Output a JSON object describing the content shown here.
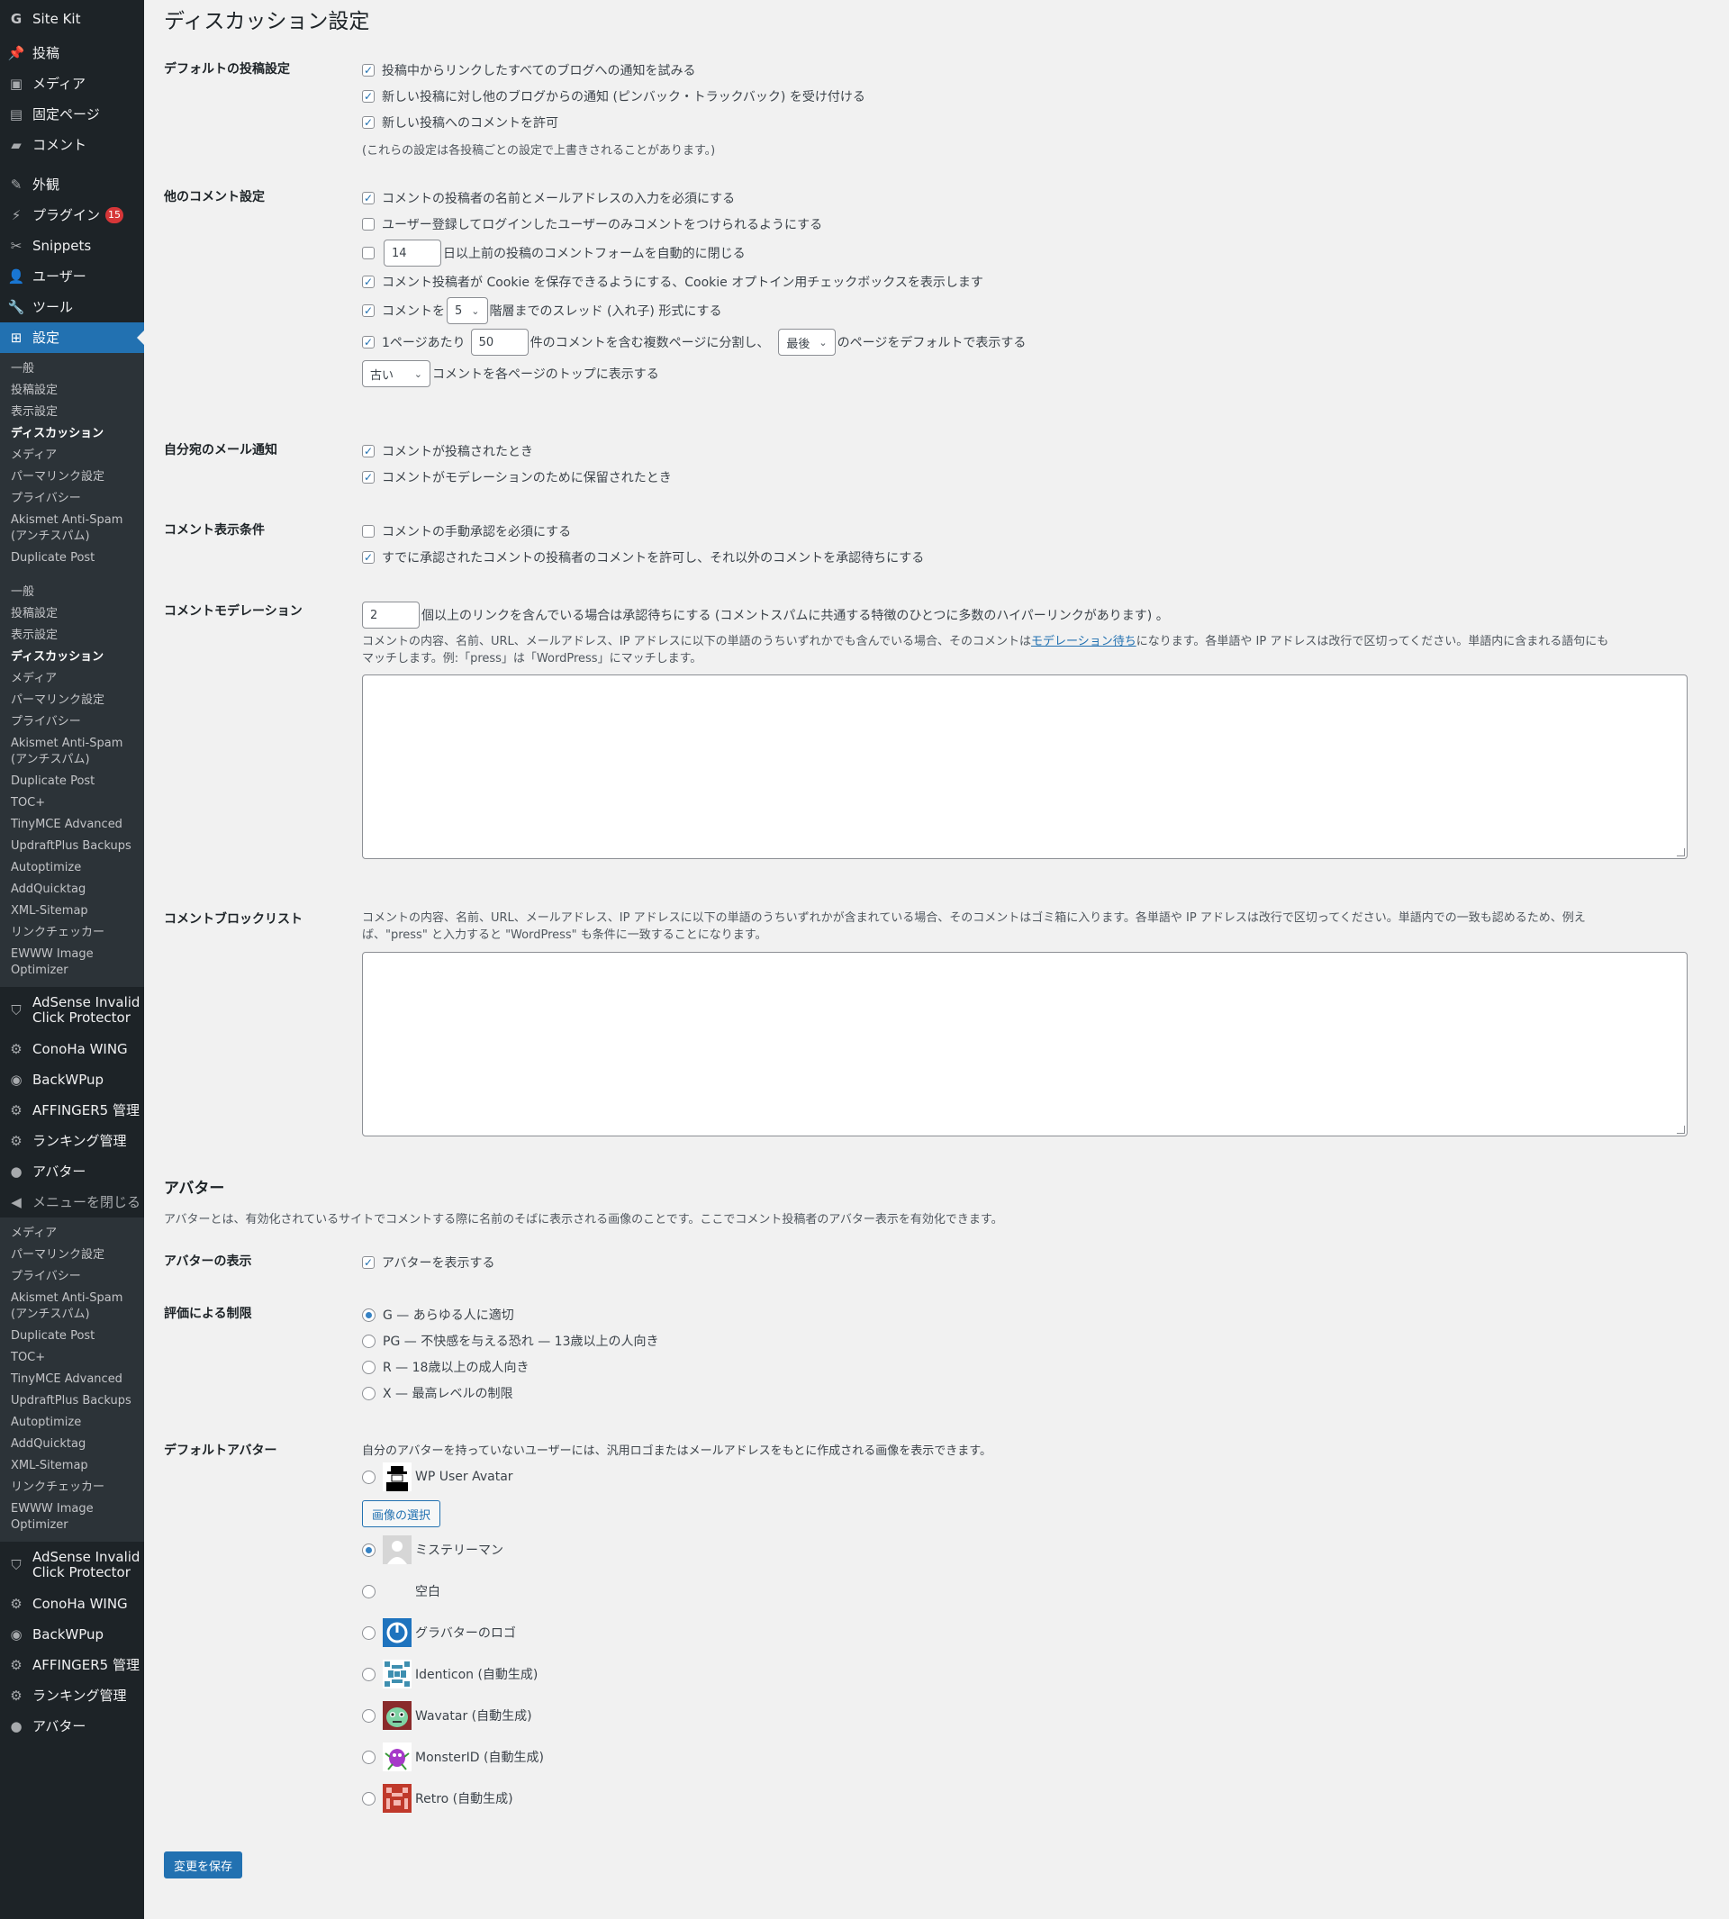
{
  "sidebar": {
    "top_items": [
      {
        "label": "Site Kit",
        "icon": "site-kit-icon"
      },
      {
        "label": "投稿",
        "icon": "pin-icon"
      },
      {
        "label": "メディア",
        "icon": "media-icon"
      },
      {
        "label": "固定ページ",
        "icon": "page-icon"
      },
      {
        "label": "コメント",
        "icon": "comment-icon"
      },
      {
        "label": "外観",
        "icon": "brush-icon"
      },
      {
        "label": "プラグイン",
        "icon": "plugin-icon",
        "badge": "15"
      },
      {
        "label": "Snippets",
        "icon": "snippets-icon"
      },
      {
        "label": "ユーザー",
        "icon": "user-icon"
      },
      {
        "label": "ツール",
        "icon": "wrench-icon"
      },
      {
        "label": "設定",
        "icon": "settings-icon"
      }
    ],
    "submenu_a": [
      "一般",
      "投稿設定",
      "表示設定",
      "ディスカッション",
      "メディア",
      "パーマリンク設定",
      "プライバシー",
      "Akismet Anti-Spam (アンチスパム)",
      "Duplicate Post"
    ],
    "submenu_b": [
      "一般",
      "投稿設定",
      "表示設定",
      "ディスカッション",
      "メディア",
      "パーマリンク設定",
      "プライバシー",
      "Akismet Anti-Spam (アンチスパム)",
      "Duplicate Post",
      "TOC+",
      "TinyMCE Advanced",
      "UpdraftPlus Backups",
      "Autoptimize",
      "AddQuicktag",
      "XML-Sitemap",
      "リンクチェッカー",
      "EWWW Image Optimizer"
    ],
    "plugin_items_a": [
      {
        "label": "AdSense Invalid Click Protector",
        "icon": "shield-icon"
      },
      {
        "label": "ConoHa WING",
        "icon": "gear-icon"
      },
      {
        "label": "BackWPup",
        "icon": "backwpup-icon"
      },
      {
        "label": "AFFINGER5 管理",
        "icon": "gear-icon"
      },
      {
        "label": "ランキング管理",
        "icon": "gear-icon"
      },
      {
        "label": "アバター",
        "icon": "avatar-menu-icon"
      },
      {
        "label": "メニューを閉じる",
        "icon": "collapse-icon"
      }
    ],
    "submenu_c": [
      "メディア",
      "パーマリンク設定",
      "プライバシー",
      "Akismet Anti-Spam (アンチスパム)",
      "Duplicate Post",
      "TOC+",
      "TinyMCE Advanced",
      "UpdraftPlus Backups",
      "Autoptimize",
      "AddQuicktag",
      "XML-Sitemap",
      "リンクチェッカー",
      "EWWW Image Optimizer"
    ],
    "plugin_items_b": [
      {
        "label": "AdSense Invalid Click Protector",
        "icon": "shield-icon"
      },
      {
        "label": "ConoHa WING",
        "icon": "gear-icon"
      },
      {
        "label": "BackWPup",
        "icon": "backwpup-icon"
      },
      {
        "label": "AFFINGER5 管理",
        "icon": "gear-icon"
      },
      {
        "label": "ランキング管理",
        "icon": "gear-icon"
      },
      {
        "label": "アバター",
        "icon": "avatar-menu-icon"
      }
    ]
  },
  "page": {
    "title": "ディスカッション設定",
    "default_post": {
      "label": "デフォルトの投稿設定",
      "opt1": "投稿中からリンクしたすべてのブログへの通知を試みる",
      "opt2": "新しい投稿に対し他のブログからの通知 (ピンバック・トラックバック) を受け付ける",
      "opt3": "新しい投稿へのコメントを許可",
      "note": "(これらの設定は各投稿ごとの設定で上書きされることがあります。)"
    },
    "other_comment": {
      "label": "他のコメント設定",
      "opt1": "コメントの投稿者の名前とメールアドレスの入力を必須にする",
      "opt2": "ユーザー登録してログインしたユーザーのみコメントをつけられるようにする",
      "close_days": "14",
      "close_text": "日以上前の投稿のコメントフォームを自動的に閉じる",
      "cookie_text": "コメント投稿者が Cookie を保存できるようにする、Cookie オプトイン用チェックボックスを表示します",
      "thread_pre": "コメントを",
      "thread_level": "5",
      "thread_post": "階層までのスレッド (入れ子) 形式にする",
      "page_pre": "1ページあたり",
      "per_page": "50",
      "page_mid": "件のコメントを含む複数ページに分割し、",
      "page_sel": "最後",
      "page_post": "のページをデフォルトで表示する",
      "order_sel": "古い",
      "order_post": "コメントを各ページのトップに表示する"
    },
    "email": {
      "label": "自分宛のメール通知",
      "opt1": "コメントが投稿されたとき",
      "opt2": "コメントがモデレーションのために保留されたとき"
    },
    "appear": {
      "label": "コメント表示条件",
      "opt1": "コメントの手動承認を必須にする",
      "opt2": "すでに承認されたコメントの投稿者のコメントを許可し、それ以外のコメントを承認待ちにする"
    },
    "moderation": {
      "label": "コメントモデレーション",
      "links": "2",
      "links_text": "個以上のリンクを含んでいる場合は承認待ちにする (コメントスパムに共通する特徴のひとつに多数のハイパーリンクがあります) 。",
      "desc_pre": "コメントの内容、名前、URL、メールアドレス、IP アドレスに以下の単語のうちいずれかでも含んでいる場合、そのコメントは",
      "desc_link": "モデレーション待ち",
      "desc_post": "になります。各単語や IP アドレスは改行で区切ってください。単語内に含まれる語句にも",
      "desc_line2": "マッチします。例:「press」は「WordPress」にマッチします。"
    },
    "blocklist": {
      "label": "コメントブロックリスト",
      "desc1": "コメントの内容、名前、URL、メールアドレス、IP アドレスに以下の単語のうちいずれかが含まれている場合、そのコメントはゴミ箱に入ります。各単語や IP アドレスは改行で区切ってください。単語内での一致も認めるため、例え",
      "desc2": "ば、\"press\" と入力すると \"WordPress\" も条件に一致することになります。"
    },
    "avatars": {
      "heading": "アバター",
      "intro": "アバターとは、有効化されているサイトでコメントする際に名前のそばに表示される画像のことです。ここでコメント投稿者のアバター表示を有効化できます。",
      "show_label": "アバターの表示",
      "show_text": "アバターを表示する",
      "rating_label": "評価による制限",
      "ratings": [
        "G — あらゆる人に適切",
        "PG — 不快感を与える恐れ — 13歳以上の人向き",
        "R — 18歳以上の成人向き",
        "X — 最高レベルの制限"
      ],
      "default_label": "デフォルトアバター",
      "default_desc": "自分のアバターを持っていないユーザーには、汎用ロゴまたはメールアドレスをもとに作成される画像を表示できます。",
      "wp_user_avatar": "WP User Avatar",
      "select_image": "画像の選択",
      "options": [
        "ミステリーマン",
        "空白",
        "グラバターのロゴ",
        "Identicon (自動生成)",
        "Wavatar (自動生成)",
        "MonsterID (自動生成)",
        "Retro (自動生成)"
      ]
    },
    "save": "変更を保存"
  },
  "colors": {
    "accent": "#2271b1",
    "sidebar": "#1d2327",
    "submenu": "#2c3338",
    "badge": "#d63638"
  }
}
